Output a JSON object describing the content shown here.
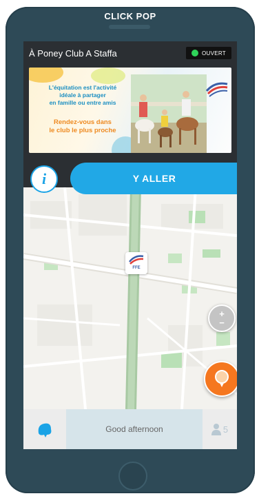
{
  "app": {
    "title": "CLICK POP"
  },
  "header": {
    "club_name": "À Poney Club A Staffa",
    "status_label": "OUVERT"
  },
  "banner": {
    "headline_lines": [
      "L'équitation est l'activité",
      "idéale à partager",
      "en famille ou entre amis"
    ],
    "cta_lines": [
      "Rendez-vous dans",
      "le club le plus proche"
    ]
  },
  "actions": {
    "info_label": "i",
    "go_label": "Y ALLER"
  },
  "map": {
    "zoom_in": "+",
    "zoom_out": "−"
  },
  "bottom": {
    "greeting": "Good afternoon",
    "friends_count": "5"
  },
  "colors": {
    "accent": "#21a8e6",
    "open": "#2fd35a",
    "locate": "#f5771f",
    "frame": "#2e4a57"
  },
  "icons": {
    "status": "green-dot-icon",
    "info": "info-icon",
    "zoom": "zoom-control-icon",
    "locate": "location-pin-icon",
    "mascot": "mascot-icon",
    "friends": "person-icon",
    "marker": "ffe-marker-icon"
  }
}
